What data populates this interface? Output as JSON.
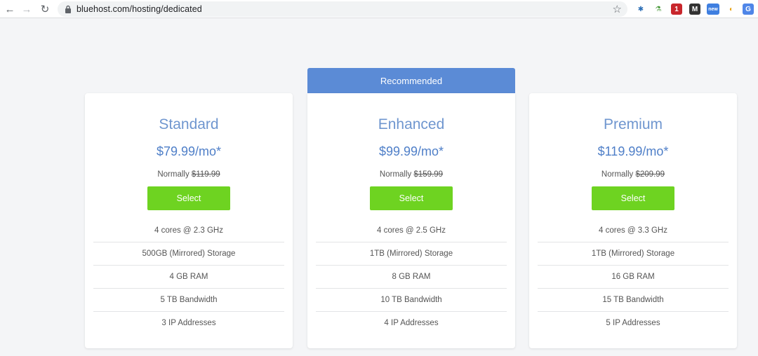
{
  "browser": {
    "url": "bluehost.com/hosting/dedicated",
    "back_icon": "←",
    "forward_icon": "→",
    "reload_icon": "↻",
    "star_icon": "☆",
    "extensions": [
      {
        "name": "ext-blue-icon",
        "glyph": "✱",
        "color": "#2d6fb6",
        "bg": "transparent"
      },
      {
        "name": "ext-flask-icon",
        "glyph": "⚗",
        "color": "#4a9a3b",
        "bg": "transparent"
      },
      {
        "name": "ext-red-badge-icon",
        "glyph": "1",
        "color": "#ffffff",
        "bg": "#c8262c"
      },
      {
        "name": "ext-m-icon",
        "glyph": "M",
        "color": "#ffffff",
        "bg": "#333333"
      },
      {
        "name": "ext-new-badge-icon",
        "glyph": "new",
        "color": "#ffffff",
        "bg": "#3f7fe0"
      },
      {
        "name": "ext-bird-icon",
        "glyph": "◐",
        "color": "#e8a10c",
        "bg": "transparent"
      },
      {
        "name": "ext-translate-icon",
        "glyph": "G",
        "color": "#ffffff",
        "bg": "#4f86e8"
      }
    ]
  },
  "recommended_label": "Recommended",
  "normally_label": "Normally",
  "select_label": "Select",
  "plans": [
    {
      "name": "Standard",
      "price": "$79.99/mo*",
      "normal_price": "$119.99",
      "features": [
        "4 cores @ 2.3 GHz",
        "500GB (Mirrored) Storage",
        "4 GB RAM",
        "5 TB Bandwidth",
        "3 IP Addresses"
      ]
    },
    {
      "name": "Enhanced",
      "price": "$99.99/mo*",
      "normal_price": "$159.99",
      "features": [
        "4 cores @ 2.5 GHz",
        "1TB (Mirrored) Storage",
        "8 GB RAM",
        "10 TB Bandwidth",
        "4 IP Addresses"
      ]
    },
    {
      "name": "Premium",
      "price": "$119.99/mo*",
      "normal_price": "$209.99",
      "features": [
        "4 cores @ 3.3 GHz",
        "1TB (Mirrored) Storage",
        "16 GB RAM",
        "15 TB Bandwidth",
        "5 IP Addresses"
      ]
    }
  ],
  "colors": {
    "accent_blue": "#5b8bd6",
    "select_green": "#6ed321",
    "plan_title": "#6f96cf"
  }
}
